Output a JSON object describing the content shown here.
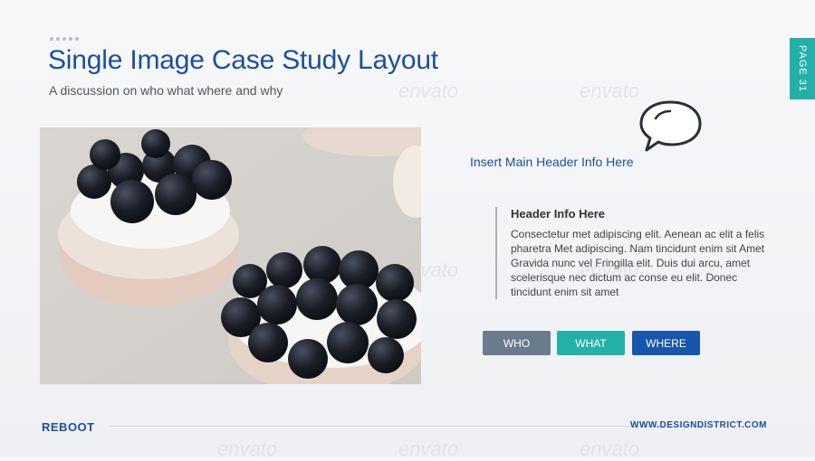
{
  "header": {
    "title": "Single Image Case Study Layout",
    "subtitle": "A discussion on who what where and why",
    "page_label": "PAGE 31"
  },
  "content": {
    "main_header": "Insert Main Header Info Here",
    "info_title": "Header Info Here",
    "info_body": "Consectetur  met adipiscing elit. Aenean ac elit a felis pharetra Met adipiscing. Nam tincidunt enim sit Amet Gravida nunc vel Fringilla elit. Duis dui arcu, amet scelerisque nec dictum ac conse eu elit. Donec tincidunt enim sit amet"
  },
  "buttons": {
    "who": "WHO",
    "what": "WHAT",
    "where": "WHERE"
  },
  "footer": {
    "brand": "REBOOT",
    "site": "WWW.DESIGNDISTRICT.COM"
  },
  "watermark": "envato",
  "colors": {
    "accent_blue": "#1c4f9c",
    "teal": "#22b1a8",
    "slate": "#6a7b8e",
    "button_blue": "#1856ac"
  }
}
